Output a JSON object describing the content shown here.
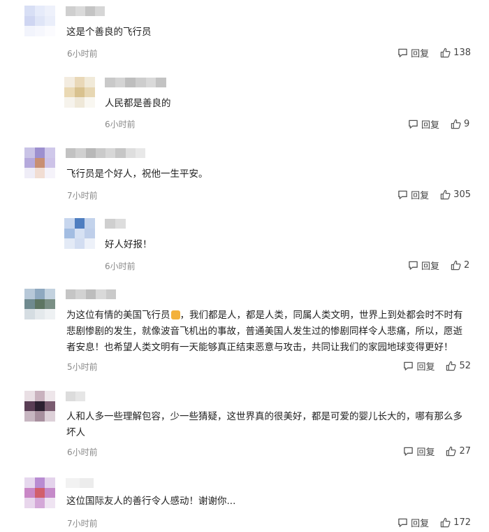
{
  "comments": [
    {
      "text": "这是个善良的飞行员",
      "time": "6小时前",
      "reply": "回复",
      "likes": "138"
    },
    {
      "text": "人民都是善良的",
      "time": "6小时前",
      "reply": "回复",
      "likes": "9"
    },
    {
      "text": "飞行员是个好人，祝他一生平安。",
      "time": "7小时前",
      "reply": "回复",
      "likes": "305"
    },
    {
      "text": "好人好报！",
      "time": "6小时前",
      "reply": "回复",
      "likes": "2"
    },
    {
      "text_line1": "为这位有情的美国飞行员",
      "text_line1b": "，我们都是人，都是人类，同属人类文明，世界上到处都会时不时有",
      "text_line2": "悲剧惨剧的发生，就像波音飞机出的事故，普通美国人发生过的惨剧同样令人悲痛，所以，愿逝",
      "text_line3": "者安息！也希望人类文明有一天能够真正结束恶意与攻击，共同让我们的家园地球变得更好！",
      "time": "5小时前",
      "reply": "回复",
      "likes": "52"
    },
    {
      "text_line1": "人和人多一些理解包容，少一些猜疑，这世界真的很美好，都是可爱的婴儿长大的，哪有那么多",
      "text_line2": "坏人",
      "time": "6小时前",
      "reply": "回复",
      "likes": "27"
    },
    {
      "text": "这位国际友人的善行令人感动！谢谢你...",
      "time": "7小时前",
      "reply": "回复",
      "likes": "172"
    }
  ],
  "icons": {
    "reply": "comment-bubble-icon",
    "like": "thumbs-up-icon",
    "emoji": "thumbs-up-emoji"
  }
}
